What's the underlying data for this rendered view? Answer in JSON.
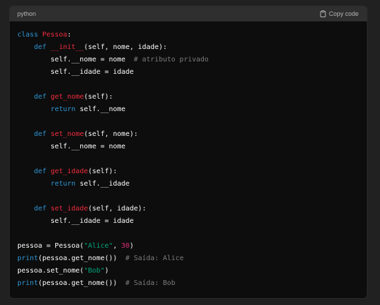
{
  "header": {
    "language": "python",
    "copy_label": "Copy code",
    "copy_icon": "clipboard-icon"
  },
  "colors": {
    "keyword": "#2e95d3",
    "function": "#f22c3d",
    "string": "#00a67d",
    "number": "#df3079",
    "comment": "#7c7c7c",
    "plain": "#ffffff",
    "background": "#0d0d0d",
    "header_bg": "#2f2f2f"
  },
  "code": {
    "lines": [
      [
        {
          "t": "kw",
          "v": "class "
        },
        {
          "t": "fn",
          "v": "Pessoa"
        },
        {
          "t": "pl",
          "v": ":"
        }
      ],
      [
        {
          "t": "pl",
          "v": "    "
        },
        {
          "t": "kw",
          "v": "def "
        },
        {
          "t": "fn",
          "v": "__init__"
        },
        {
          "t": "pl",
          "v": "(self, nome, idade):"
        }
      ],
      [
        {
          "t": "pl",
          "v": "        self.__nome = nome  "
        },
        {
          "t": "com",
          "v": "# atributo privado"
        }
      ],
      [
        {
          "t": "pl",
          "v": "        self.__idade = idade"
        }
      ],
      [],
      [
        {
          "t": "pl",
          "v": "    "
        },
        {
          "t": "kw",
          "v": "def "
        },
        {
          "t": "fn",
          "v": "get_nome"
        },
        {
          "t": "pl",
          "v": "(self):"
        }
      ],
      [
        {
          "t": "pl",
          "v": "        "
        },
        {
          "t": "kw",
          "v": "return "
        },
        {
          "t": "pl",
          "v": "self.__nome"
        }
      ],
      [],
      [
        {
          "t": "pl",
          "v": "    "
        },
        {
          "t": "kw",
          "v": "def "
        },
        {
          "t": "fn",
          "v": "set_nome"
        },
        {
          "t": "pl",
          "v": "(self, nome):"
        }
      ],
      [
        {
          "t": "pl",
          "v": "        self.__nome = nome"
        }
      ],
      [],
      [
        {
          "t": "pl",
          "v": "    "
        },
        {
          "t": "kw",
          "v": "def "
        },
        {
          "t": "fn",
          "v": "get_idade"
        },
        {
          "t": "pl",
          "v": "(self):"
        }
      ],
      [
        {
          "t": "pl",
          "v": "        "
        },
        {
          "t": "kw",
          "v": "return "
        },
        {
          "t": "pl",
          "v": "self.__idade"
        }
      ],
      [],
      [
        {
          "t": "pl",
          "v": "    "
        },
        {
          "t": "kw",
          "v": "def "
        },
        {
          "t": "fn",
          "v": "set_idade"
        },
        {
          "t": "pl",
          "v": "(self, idade):"
        }
      ],
      [
        {
          "t": "pl",
          "v": "        self.__idade = idade"
        }
      ],
      [],
      [
        {
          "t": "pl",
          "v": "pessoa = Pessoa("
        },
        {
          "t": "str",
          "v": "\"Alice\""
        },
        {
          "t": "pl",
          "v": ", "
        },
        {
          "t": "num",
          "v": "30"
        },
        {
          "t": "pl",
          "v": ")"
        }
      ],
      [
        {
          "t": "kw",
          "v": "print"
        },
        {
          "t": "pl",
          "v": "(pessoa.get_nome())  "
        },
        {
          "t": "com",
          "v": "# Saída: Alice"
        }
      ],
      [
        {
          "t": "pl",
          "v": "pessoa.set_nome("
        },
        {
          "t": "str",
          "v": "\"Bob\""
        },
        {
          "t": "pl",
          "v": ")"
        }
      ],
      [
        {
          "t": "kw",
          "v": "print"
        },
        {
          "t": "pl",
          "v": "(pessoa.get_nome())  "
        },
        {
          "t": "com",
          "v": "# Saída: Bob"
        }
      ]
    ]
  }
}
